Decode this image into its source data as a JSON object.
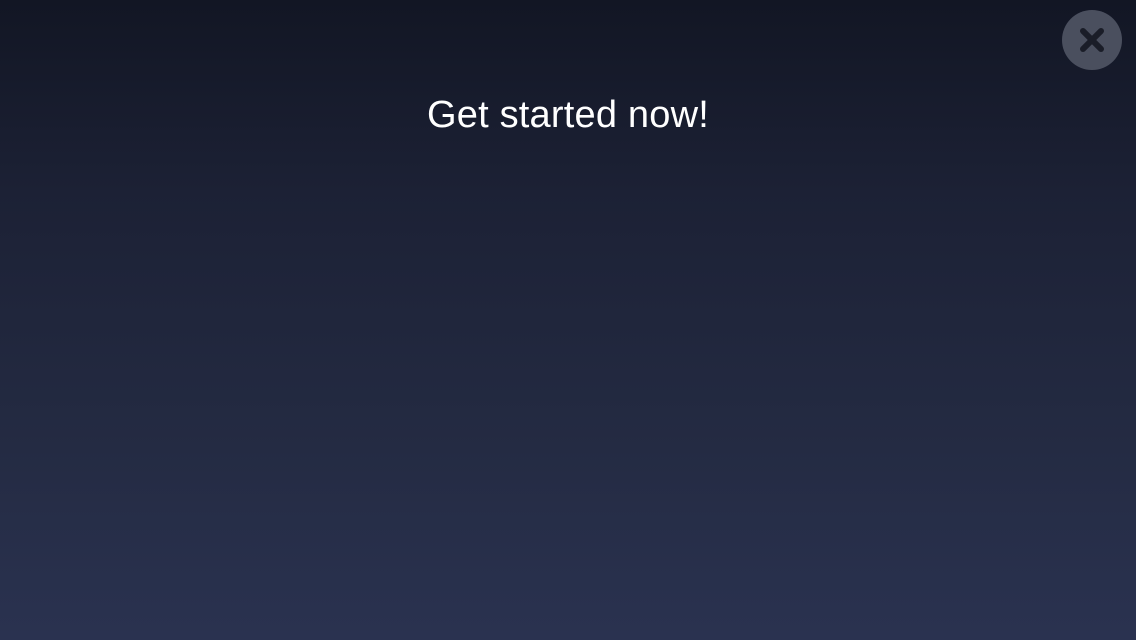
{
  "screen": {
    "title": "Get started now!"
  },
  "close_button": {
    "icon": "close-icon",
    "icon_color": "#1a1d28",
    "background_color": "#4a4f5e"
  },
  "colors": {
    "background_top": "#121624",
    "background_bottom": "#2a3250",
    "text": "#ffffff"
  }
}
